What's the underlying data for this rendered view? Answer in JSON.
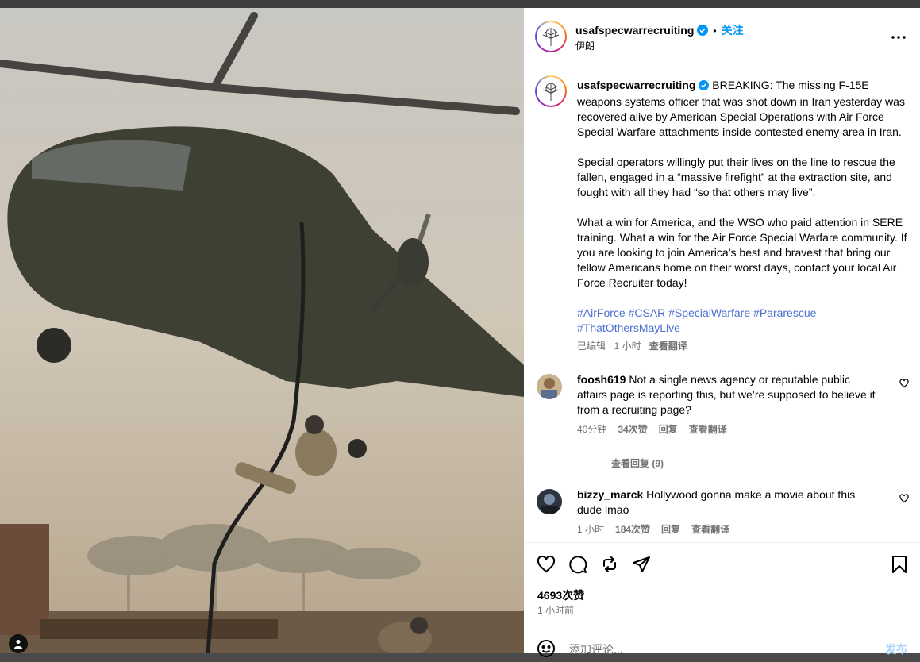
{
  "post": {
    "username": "usafspecwarrecruiting",
    "follow_label": "关注",
    "separator": "•",
    "location": "伊朗"
  },
  "caption": {
    "username": "usafspecwarrecruiting",
    "p1": "BREAKING: The missing F-15E weapons systems officer that was shot down in Iran yesterday was recovered alive by American Special Operations with Air Force Special Warfare attachments inside contested enemy area in Iran.",
    "p2": "Special operators willingly put their lives on the line to rescue the fallen, engaged in a “massive firefight” at the extraction site, and fought with all they had “so that others may live”.",
    "p3": "What a win for America, and the WSO who paid attention in SERE training. What a win for the Air Force Special Warfare community. If you are looking to join America’s best and bravest that bring our fellow Americans home on their worst days, contact your local Air Force Recruiter today!",
    "hashtags": [
      "#AirForce",
      "#CSAR",
      "#SpecialWarfare",
      "#Pararescue",
      "#ThatOthersMayLive"
    ],
    "meta": "已编辑 · 1 小时",
    "translate": "查看翻译"
  },
  "comments": [
    {
      "username": "foosh619",
      "text": "Not a single news agency or reputable public affairs page is reporting this, but we’re supposed to believe it from a recruiting page?",
      "time": "40分钟",
      "likes": "34次赞",
      "reply": "回复",
      "translate": "查看翻译"
    },
    {
      "username": "bizzy_marck",
      "text": "Hollywood gonna make a movie about this dude lmao",
      "time": "1 小时",
      "likes": "184次赞",
      "reply": "回复",
      "translate": "查看翻译"
    }
  ],
  "view_replies": "查看回复 (9)",
  "footer": {
    "likes": "4693次赞",
    "time": "1 小时前",
    "comment_placeholder": "添加评论...",
    "post_label": "发布"
  },
  "colors": {
    "link_blue": "#0095f6",
    "hashtag": "#4c6fd1",
    "muted": "#737373",
    "post_disabled": "#a8d3fb"
  },
  "icons": [
    "more-icon",
    "verified-icon",
    "heart-icon",
    "comment-icon",
    "repost-icon",
    "share-icon",
    "bookmark-icon",
    "smile-icon",
    "user-tag-icon"
  ]
}
